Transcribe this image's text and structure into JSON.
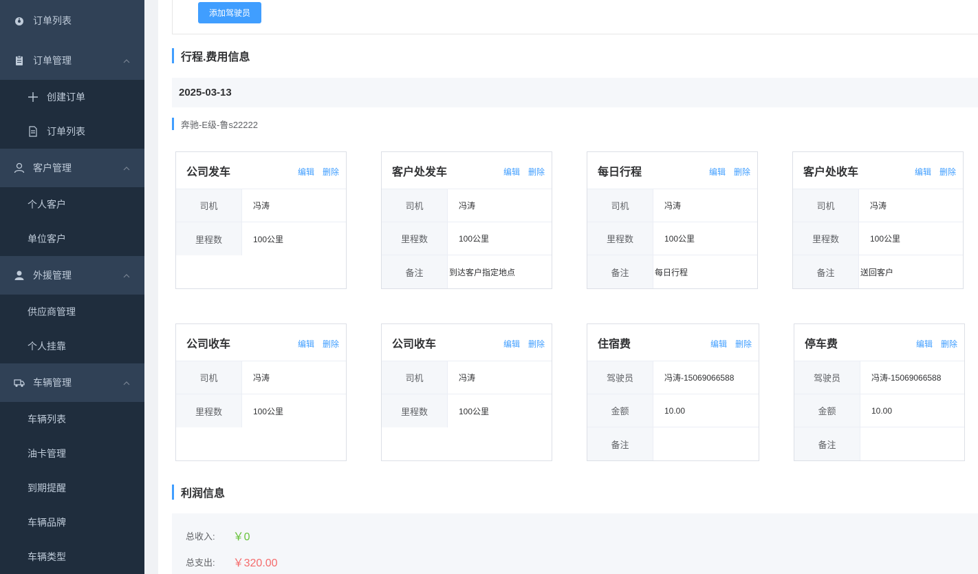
{
  "sidebar": {
    "top_item": "订单列表",
    "groups": [
      {
        "title": "订单管理",
        "items": [
          "创建订单",
          "订单列表"
        ]
      },
      {
        "title": "客户管理",
        "items": [
          "个人客户",
          "单位客户"
        ]
      },
      {
        "title": "外援管理",
        "items": [
          "供应商管理",
          "个人挂靠"
        ]
      },
      {
        "title": "车辆管理",
        "items": [
          "车辆列表",
          "油卡管理",
          "到期提醒",
          "车辆品牌",
          "车辆类型"
        ]
      }
    ]
  },
  "main": {
    "add_driver_button": "添加驾驶员",
    "trip_section_title": "行程.费用信息",
    "date": "2025-03-13",
    "vehicle": "奔驰-E级-鲁s22222",
    "edit_label": "编辑",
    "delete_label": "删除",
    "cards": [
      {
        "title": "公司发车",
        "rows": [
          {
            "k": "司机",
            "v": "冯涛"
          },
          {
            "k": "里程数",
            "v": "100公里"
          }
        ]
      },
      {
        "title": "客户处发车",
        "rows": [
          {
            "k": "司机",
            "v": "冯涛"
          },
          {
            "k": "里程数",
            "v": "100公里"
          },
          {
            "k": "备注",
            "v": "到达客户指定地点"
          }
        ]
      },
      {
        "title": "每日行程",
        "rows": [
          {
            "k": "司机",
            "v": "冯涛"
          },
          {
            "k": "里程数",
            "v": "100公里"
          },
          {
            "k": "备注",
            "v": "每日行程"
          }
        ]
      },
      {
        "title": "客户处收车",
        "rows": [
          {
            "k": "司机",
            "v": "冯涛"
          },
          {
            "k": "里程数",
            "v": "100公里"
          },
          {
            "k": "备注",
            "v": "送回客户"
          }
        ]
      },
      {
        "title": "公司收车",
        "rows": [
          {
            "k": "司机",
            "v": "冯涛"
          },
          {
            "k": "里程数",
            "v": "100公里"
          }
        ]
      },
      {
        "title": "公司收车",
        "rows": [
          {
            "k": "司机",
            "v": "冯涛"
          },
          {
            "k": "里程数",
            "v": "100公里"
          }
        ]
      },
      {
        "title": "住宿费",
        "rows": [
          {
            "k": "驾驶员",
            "v": "冯涛-15069066588"
          },
          {
            "k": "金额",
            "v": "10.00"
          },
          {
            "k": "备注",
            "v": ""
          }
        ]
      },
      {
        "title": "停车费",
        "rows": [
          {
            "k": "驾驶员",
            "v": "冯涛-15069066588"
          },
          {
            "k": "金额",
            "v": "10.00"
          },
          {
            "k": "备注",
            "v": ""
          }
        ]
      }
    ],
    "profit_section_title": "利润信息",
    "total_income_label": "总收入:",
    "total_income_value": "￥0",
    "total_expense_label": "总支出:",
    "total_expense_value": "￥320.00",
    "colors": {
      "accent": "#409eff",
      "income": "#67c23a",
      "expense": "#f56c6c"
    }
  }
}
